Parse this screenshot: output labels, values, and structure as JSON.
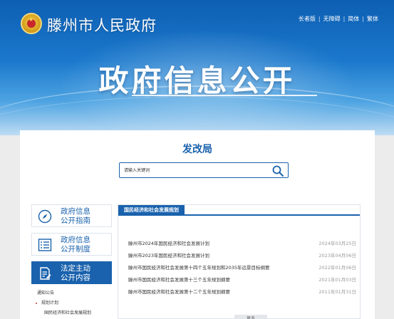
{
  "header": {
    "site_title": "滕州市人民政府",
    "top_links": [
      "长者版",
      "无障碍",
      "简体",
      "繁体"
    ],
    "banner_title": "政府信息公开"
  },
  "department": {
    "title": "发改局"
  },
  "search": {
    "placeholder": "请输入关键词"
  },
  "sidebar": {
    "items": [
      {
        "label_line1": "政府信息",
        "label_line2": "公开指南",
        "icon": "compass-icon",
        "active": false
      },
      {
        "label_line1": "政府信息",
        "label_line2": "公开制度",
        "icon": "list-icon",
        "active": false
      },
      {
        "label_line1": "法定主动",
        "label_line2": "公开内容",
        "icon": "document-edit-icon",
        "active": true
      }
    ],
    "sub_items": [
      {
        "label": "通知公告",
        "level": 1
      },
      {
        "label": "规划计划",
        "level": 2
      },
      {
        "label": "国民经济和社会发展规划",
        "level": 3
      }
    ]
  },
  "content": {
    "tab_label": "国民经济和社会发展规划",
    "rows": [
      {
        "title": "滕州市2024年国民经济和社会发展计划",
        "date": "2024年03月25日"
      },
      {
        "title": "滕州市2023年国民经济和社会发展计划",
        "date": "2023年04月06日"
      },
      {
        "title": "滕州市国民经济和社会发展第十四个五年规划和2035年远景目标纲要",
        "date": "2022年01月06日"
      },
      {
        "title": "滕州市国民经济和社会发展第十三个五年规划纲要",
        "date": "2021年01月03日"
      },
      {
        "title": "滕州市国民经济和社会发展第十二个五年规划纲要",
        "date": "2011年01月31日"
      }
    ],
    "more_label": "更多"
  },
  "colors": {
    "brand_blue": "#1a62ad",
    "banner_top": "#0e5fb3",
    "page_bg": "#ececec"
  }
}
